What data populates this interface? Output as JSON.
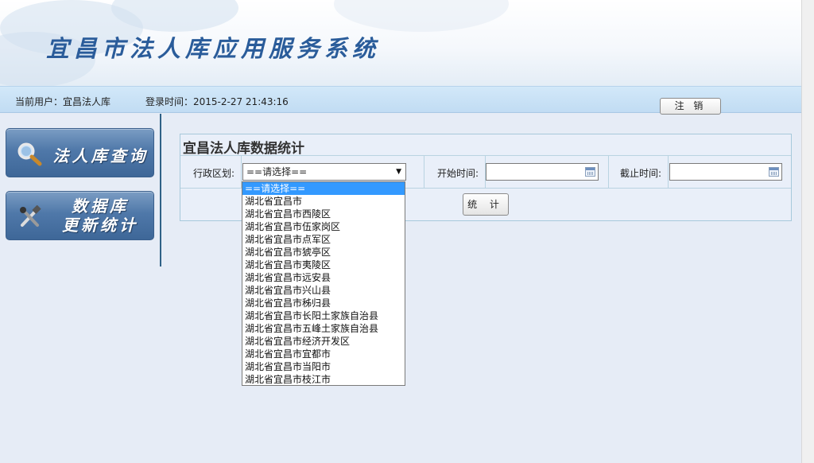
{
  "app": {
    "title": "宜昌市法人库应用服务系统"
  },
  "userbar": {
    "current_user": "当前用户：宜昌法人库",
    "login_time": "登录时间：2015-2-27 21:43:16",
    "logout_label": "注 销"
  },
  "sidebar": {
    "items": [
      {
        "label": "法人库查询",
        "icon": "search-icon"
      },
      {
        "label_line1": "数据库",
        "label_line2": "更新统计",
        "icon": "tools-icon"
      }
    ]
  },
  "stats": {
    "title": "宜昌法人库数据统计",
    "region_label": "行政区划:",
    "region_value": "==请选择==",
    "start_label": "开始时间:",
    "start_value": "",
    "end_label": "截止时间:",
    "end_value": "",
    "submit_label": "统 计"
  },
  "dropdown": {
    "options": [
      "==请选择==",
      "湖北省宜昌市",
      "湖北省宜昌市西陵区",
      "湖北省宜昌市伍家岗区",
      "湖北省宜昌市点军区",
      "湖北省宜昌市猇亭区",
      "湖北省宜昌市夷陵区",
      "湖北省宜昌市远安县",
      "湖北省宜昌市兴山县",
      "湖北省宜昌市秭归县",
      "湖北省宜昌市长阳土家族自治县",
      "湖北省宜昌市五峰土家族自治县",
      "湖北省宜昌市经济开发区",
      "湖北省宜昌市宜都市",
      "湖北省宜昌市当阳市",
      "湖北省宜昌市枝江市"
    ],
    "selected_index": 0
  },
  "colors": {
    "accent": "#3399ff",
    "brand": "#2a5c9a",
    "sidebar_button": "#4f78a9"
  }
}
